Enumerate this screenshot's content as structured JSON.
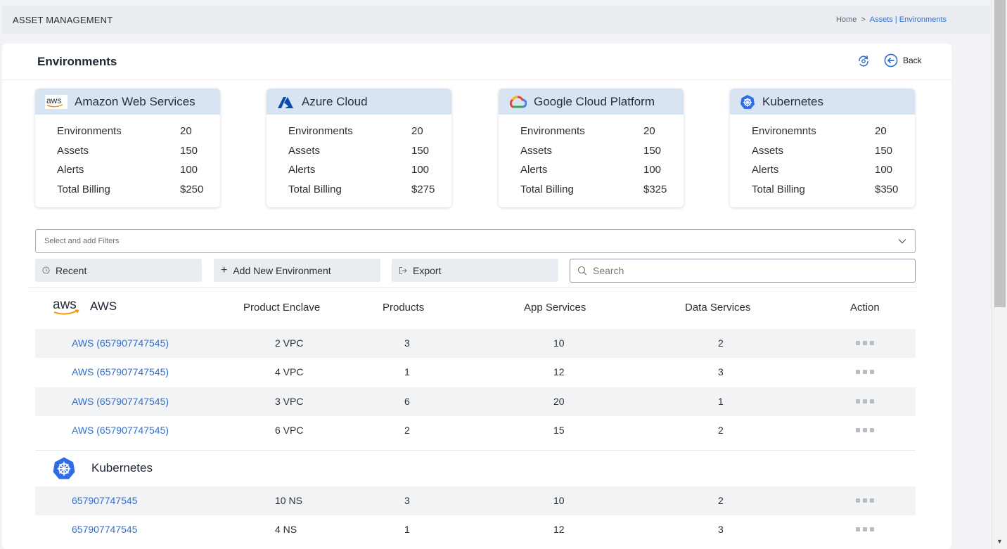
{
  "app": {
    "title": "ASSET MANAGEMENT"
  },
  "breadcrumb": {
    "home": "Home",
    "sep": ">",
    "current": "Assets | Environments"
  },
  "page": {
    "title": "Environments",
    "back_label": "Back"
  },
  "providers": [
    {
      "name": "Amazon Web Services",
      "icon": "aws-icon",
      "rows": [
        [
          "Environments",
          "20"
        ],
        [
          "Assets",
          "150"
        ],
        [
          "Alerts",
          "100"
        ],
        [
          "Total Billing",
          "$250"
        ]
      ]
    },
    {
      "name": "Azure Cloud",
      "icon": "azure-icon",
      "rows": [
        [
          "Environments",
          "20"
        ],
        [
          "Assets",
          "150"
        ],
        [
          "Alerts",
          "100"
        ],
        [
          "Total Billing",
          "$275"
        ]
      ]
    },
    {
      "name": "Google Cloud Platform",
      "icon": "gcp-icon",
      "rows": [
        [
          "Environments",
          "20"
        ],
        [
          "Assets",
          "150"
        ],
        [
          "Alerts",
          "100"
        ],
        [
          "Total Billing",
          "$325"
        ]
      ]
    },
    {
      "name": "Kubernetes",
      "icon": "kubernetes-icon",
      "rows": [
        [
          "Environemnts",
          "20"
        ],
        [
          "Assets",
          "150"
        ],
        [
          "Alerts",
          "100"
        ],
        [
          "Total Billing",
          "$350"
        ]
      ]
    }
  ],
  "filters": {
    "placeholder": "Select and add Filters"
  },
  "toolbar": {
    "recent": "Recent",
    "add": "Add New Environment",
    "export": "Export",
    "search_placeholder": "Search"
  },
  "table": {
    "columns": [
      "Product Enclave",
      "Products",
      "App Services",
      "Data Services",
      "Action"
    ],
    "groups": [
      {
        "name": "AWS",
        "icon_text": "aws",
        "rows": [
          [
            "AWS (657907747545)",
            "2 VPC",
            "3",
            "10",
            "2"
          ],
          [
            "AWS (657907747545)",
            "4 VPC",
            "1",
            "12",
            "3"
          ],
          [
            "AWS (657907747545)",
            "3 VPC",
            "6",
            "20",
            "1"
          ],
          [
            "AWS (657907747545)",
            "6 VPC",
            "2",
            "15",
            "2"
          ]
        ]
      },
      {
        "name": "Kubernetes",
        "rows": [
          [
            "657907747545",
            "10 NS",
            "3",
            "10",
            "2"
          ],
          [
            "657907747545",
            "4 NS",
            "1",
            "12",
            "3"
          ]
        ]
      }
    ]
  },
  "colors": {
    "accent": "#2f6fd0",
    "card_head": "#d9e4f3",
    "azure": "#0a4aa8",
    "kubernetes": "#326ce5"
  }
}
